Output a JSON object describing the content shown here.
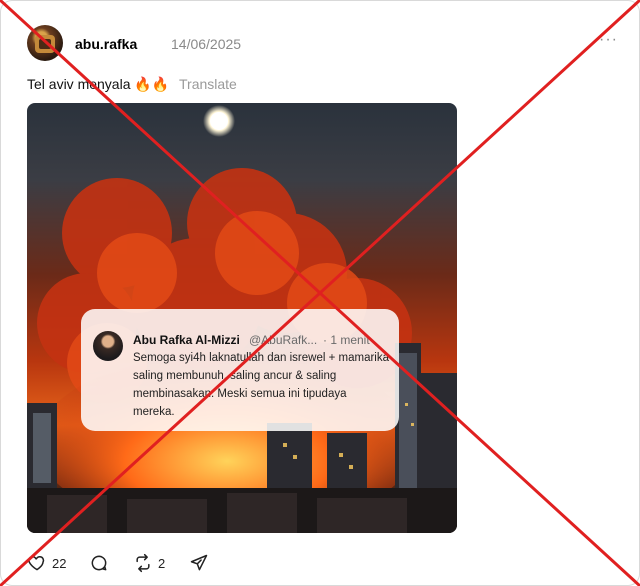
{
  "post": {
    "username": "abu.rafka",
    "date": "14/06/2025",
    "more_label": "···",
    "text": "Tel aviv menyala",
    "emoji": "🔥🔥",
    "translate_label": "Translate"
  },
  "quote": {
    "name": "Abu Rafka Al-Mizzi",
    "handle": "@AbuRafk...",
    "time": "· 1 menit",
    "body": "Semoga syi4h laknatullah dan isrewel + mamarika saling membunuh, saling ancur & saling  membinasakan. Meski semua ini tipudaya mereka."
  },
  "actions": {
    "likes": "22",
    "reposts": "2"
  },
  "icons": {
    "like": "heart-icon",
    "reply": "comment-icon",
    "repost": "repost-icon",
    "share": "send-icon",
    "more": "more-icon"
  },
  "colors": {
    "cross_mark": "#e02020",
    "secondary_text": "#8a8a8a"
  }
}
